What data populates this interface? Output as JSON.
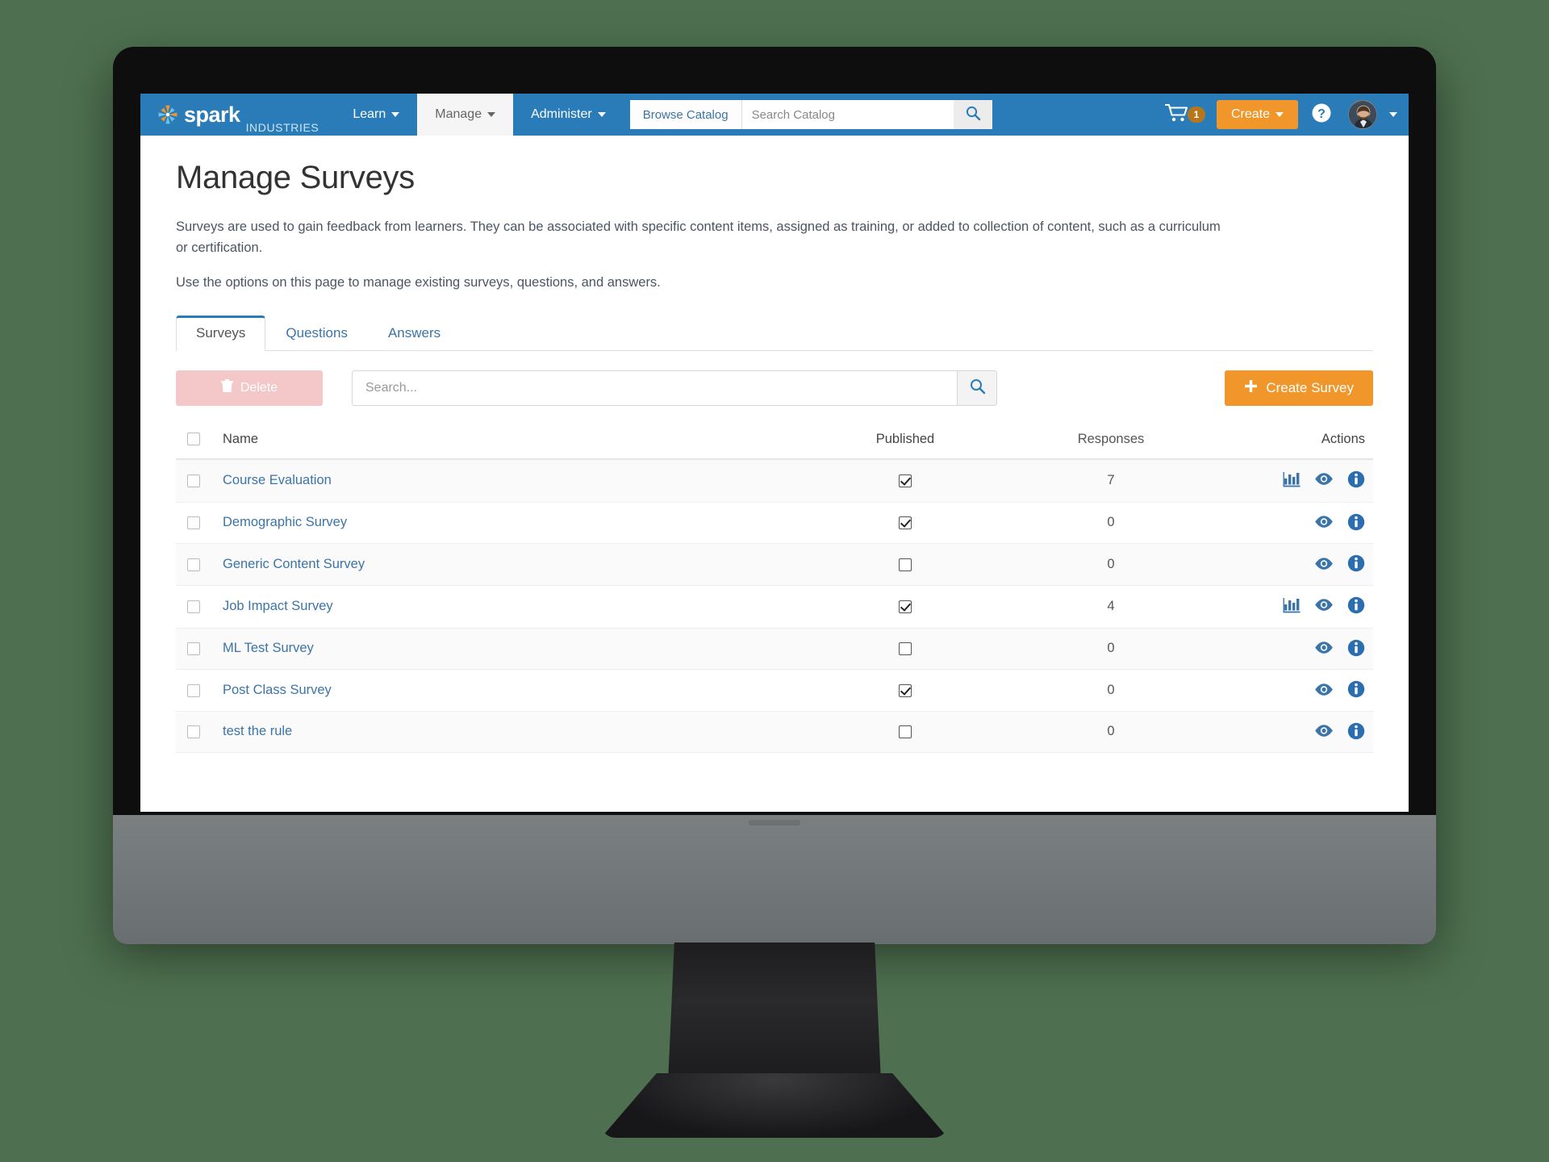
{
  "nav": {
    "brand_name": "spark",
    "brand_suffix": "INDUSTRIES",
    "brand_mark_icon": "spark-asterisk-icon",
    "items": [
      {
        "label": "Learn",
        "has_caret": true,
        "active": false
      },
      {
        "label": "Manage",
        "has_caret": true,
        "active": true
      },
      {
        "label": "Administer",
        "has_caret": true,
        "active": false
      }
    ],
    "browse_catalog_label": "Browse Catalog",
    "search_catalog_placeholder": "Search Catalog",
    "search_catalog_value": "",
    "search_icon": "magnifier-icon",
    "cart_icon": "shopping-cart-icon",
    "cart_count": "1",
    "create_label": "Create",
    "help_icon": "question-circle-icon",
    "avatar_icon": "user-avatar",
    "accent_blue": "#2a7cb8",
    "accent_orange": "#f0962a",
    "badge_brown": "#b8761c"
  },
  "page": {
    "title": "Manage Surveys",
    "description_1": "Surveys are used to gain feedback from learners. They can be associated with specific content items, assigned as training, or added to collection of content, such as a curriculum or certification.",
    "description_2": "Use the options on this page to manage existing surveys, questions, and answers."
  },
  "tabs": [
    {
      "label": "Surveys",
      "active": true
    },
    {
      "label": "Questions",
      "active": false
    },
    {
      "label": "Answers",
      "active": false
    }
  ],
  "toolbar": {
    "delete_label": "Delete",
    "delete_icon": "trash-icon",
    "search_placeholder": "Search...",
    "search_value": "",
    "search_icon": "magnifier-icon",
    "create_survey_label": "Create Survey",
    "create_survey_icon": "plus-icon"
  },
  "table": {
    "columns": {
      "select_all": "",
      "name": "Name",
      "published": "Published",
      "responses": "Responses",
      "actions": "Actions"
    },
    "select_all_checked": false,
    "rows": [
      {
        "selected": false,
        "name": "Course Evaluation",
        "published": true,
        "responses": "7",
        "actions": [
          "report-chart-icon",
          "preview-eye-icon",
          "info-icon"
        ]
      },
      {
        "selected": false,
        "name": "Demographic Survey",
        "published": true,
        "responses": "0",
        "actions": [
          "preview-eye-icon",
          "info-icon"
        ]
      },
      {
        "selected": false,
        "name": "Generic Content Survey",
        "published": false,
        "responses": "0",
        "actions": [
          "preview-eye-icon",
          "info-icon"
        ]
      },
      {
        "selected": false,
        "name": "Job Impact Survey",
        "published": true,
        "responses": "4",
        "actions": [
          "report-chart-icon",
          "preview-eye-icon",
          "info-icon"
        ]
      },
      {
        "selected": false,
        "name": "ML Test Survey",
        "published": false,
        "responses": "0",
        "actions": [
          "preview-eye-icon",
          "info-icon"
        ]
      },
      {
        "selected": false,
        "name": "Post Class Survey",
        "published": true,
        "responses": "0",
        "actions": [
          "preview-eye-icon",
          "info-icon"
        ]
      },
      {
        "selected": false,
        "name": "test the rule",
        "published": false,
        "responses": "0",
        "actions": [
          "preview-eye-icon",
          "info-icon"
        ]
      }
    ]
  }
}
